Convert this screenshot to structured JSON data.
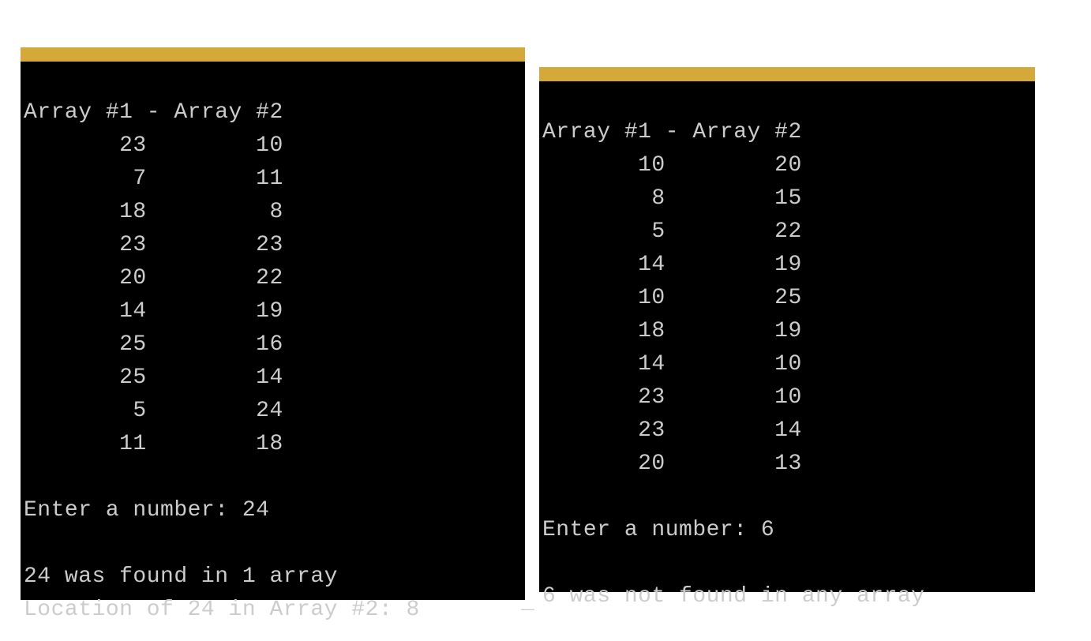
{
  "colors": {
    "titlebar": "#d4a939",
    "terminal_bg": "#000000",
    "terminal_fg": "#cccccc"
  },
  "left": {
    "header": "Array #1 - Array #2",
    "rows": [
      "       23        10",
      "        7        11",
      "       18         8",
      "       23        23",
      "       20        22",
      "       14        19",
      "       25        16",
      "       25        14",
      "        5        24",
      "       11        18"
    ],
    "blank1": "",
    "prompt": "Enter a number: 24",
    "blank2": "",
    "result1": "24 was found in 1 array",
    "result2": "Location of 24 in Array #2: 8"
  },
  "right": {
    "header": "Array #1 - Array #2",
    "rows": [
      "       10        20",
      "        8        15",
      "        5        22",
      "       14        19",
      "       10        25",
      "       18        19",
      "       14        10",
      "       23        10",
      "       23        14",
      "       20        13"
    ],
    "blank1": "",
    "prompt": "Enter a number: 6",
    "blank2": "",
    "result1": "6 was not found in any array"
  },
  "cursor": "_"
}
